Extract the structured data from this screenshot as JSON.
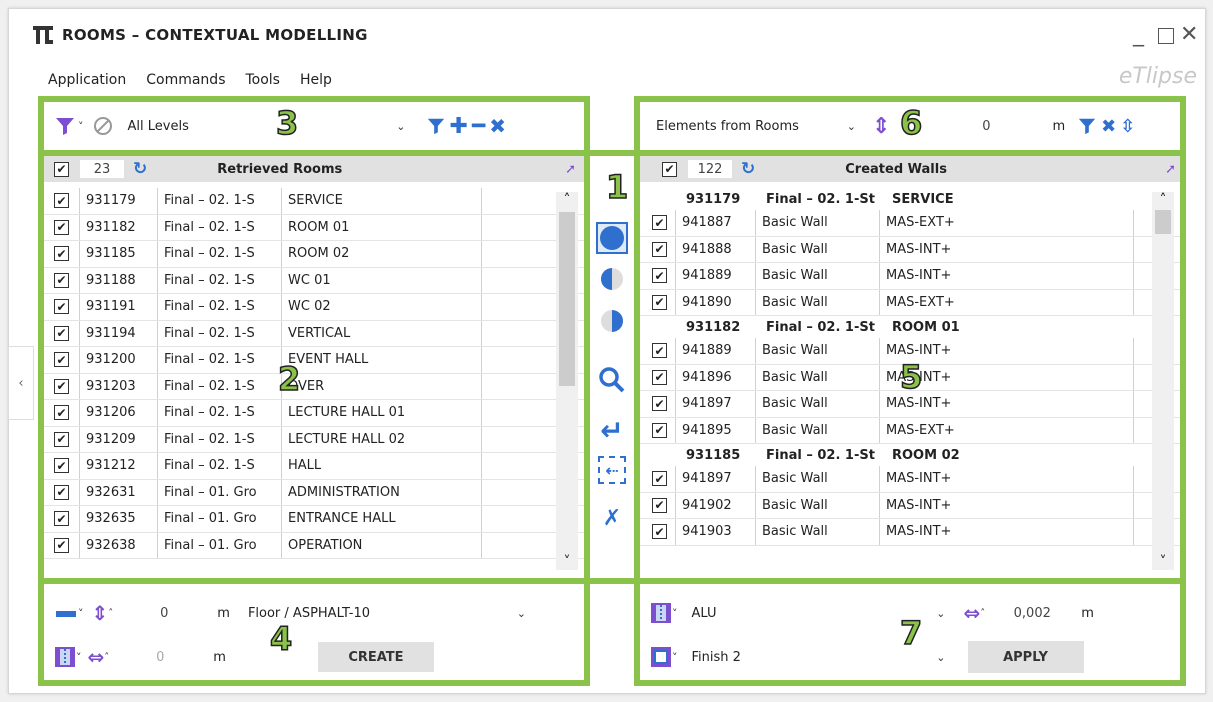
{
  "window": {
    "title": "ROOMS – CONTEXTUAL MODELLING",
    "brand": "eTlipse"
  },
  "menu": [
    "Application",
    "Commands",
    "Tools",
    "Help"
  ],
  "labels": {
    "n1": "1",
    "n2": "2",
    "n3": "3",
    "n4": "4",
    "n5": "5",
    "n6": "6",
    "n7": "7"
  },
  "left_toolbar": {
    "level_filter": "All Levels"
  },
  "left_table": {
    "count": "23",
    "title": "Retrieved Rooms",
    "rows": [
      [
        "931179",
        "Final – 02. 1-S",
        "SERVICE"
      ],
      [
        "931182",
        "Final – 02. 1-S",
        "ROOM 01"
      ],
      [
        "931185",
        "Final – 02. 1-S",
        "ROOM 02"
      ],
      [
        "931188",
        "Final – 02. 1-S",
        "WC 01"
      ],
      [
        "931191",
        "Final – 02. 1-S",
        "WC 02"
      ],
      [
        "931194",
        "Final – 02. 1-S",
        "VERTICAL"
      ],
      [
        "931200",
        "Final – 02. 1-S",
        "EVENT HALL"
      ],
      [
        "931203",
        "Final – 02. 1-S",
        "OVER"
      ],
      [
        "931206",
        "Final – 02. 1-S",
        "LECTURE HALL 01"
      ],
      [
        "931209",
        "Final – 02. 1-S",
        "LECTURE HALL 02"
      ],
      [
        "931212",
        "Final – 02. 1-S",
        "HALL"
      ],
      [
        "932631",
        "Final – 01. Gro",
        "ADMINISTRATION"
      ],
      [
        "932635",
        "Final – 01. Gro",
        "ENTRANCE HALL"
      ],
      [
        "932638",
        "Final – 01. Gro",
        "OPERATION"
      ]
    ]
  },
  "right_toolbar": {
    "source": "Elements from Rooms",
    "offset": "0",
    "unit": "m"
  },
  "right_table": {
    "count": "122",
    "title": "Created Walls",
    "groups": [
      {
        "id": "931179",
        "level": "Final – 02. 1-St",
        "name": "SERVICE",
        "rows": [
          [
            "941887",
            "Basic Wall",
            "MAS-EXT+"
          ],
          [
            "941888",
            "Basic Wall",
            "MAS-INT+"
          ],
          [
            "941889",
            "Basic Wall",
            "MAS-INT+"
          ],
          [
            "941890",
            "Basic Wall",
            "MAS-EXT+"
          ]
        ]
      },
      {
        "id": "931182",
        "level": "Final – 02. 1-St",
        "name": "ROOM 01",
        "rows": [
          [
            "941889",
            "Basic Wall",
            "MAS-INT+"
          ],
          [
            "941896",
            "Basic Wall",
            "MAS-INT+"
          ],
          [
            "941897",
            "Basic Wall",
            "MAS-INT+"
          ],
          [
            "941895",
            "Basic Wall",
            "MAS-EXT+"
          ]
        ]
      },
      {
        "id": "931185",
        "level": "Final – 02. 1-St",
        "name": "ROOM 02",
        "rows": [
          [
            "941897",
            "Basic Wall",
            "MAS-INT+"
          ],
          [
            "941902",
            "Basic Wall",
            "MAS-INT+"
          ],
          [
            "941903",
            "Basic Wall",
            "MAS-INT+"
          ]
        ]
      }
    ]
  },
  "bottom_left": {
    "height": "0",
    "unit": "m",
    "floor_type": "Floor / ASPHALT-10",
    "width": "0",
    "unit2": "m",
    "create": "CREATE"
  },
  "bottom_right": {
    "material": "ALU",
    "thickness": "0,002",
    "unit": "m",
    "finish": "Finish 2",
    "apply": "APPLY"
  },
  "colors": {
    "accent": "#8bc34a",
    "icon_blue": "#2f6fce",
    "filter_purple": "#7b4fd0"
  }
}
